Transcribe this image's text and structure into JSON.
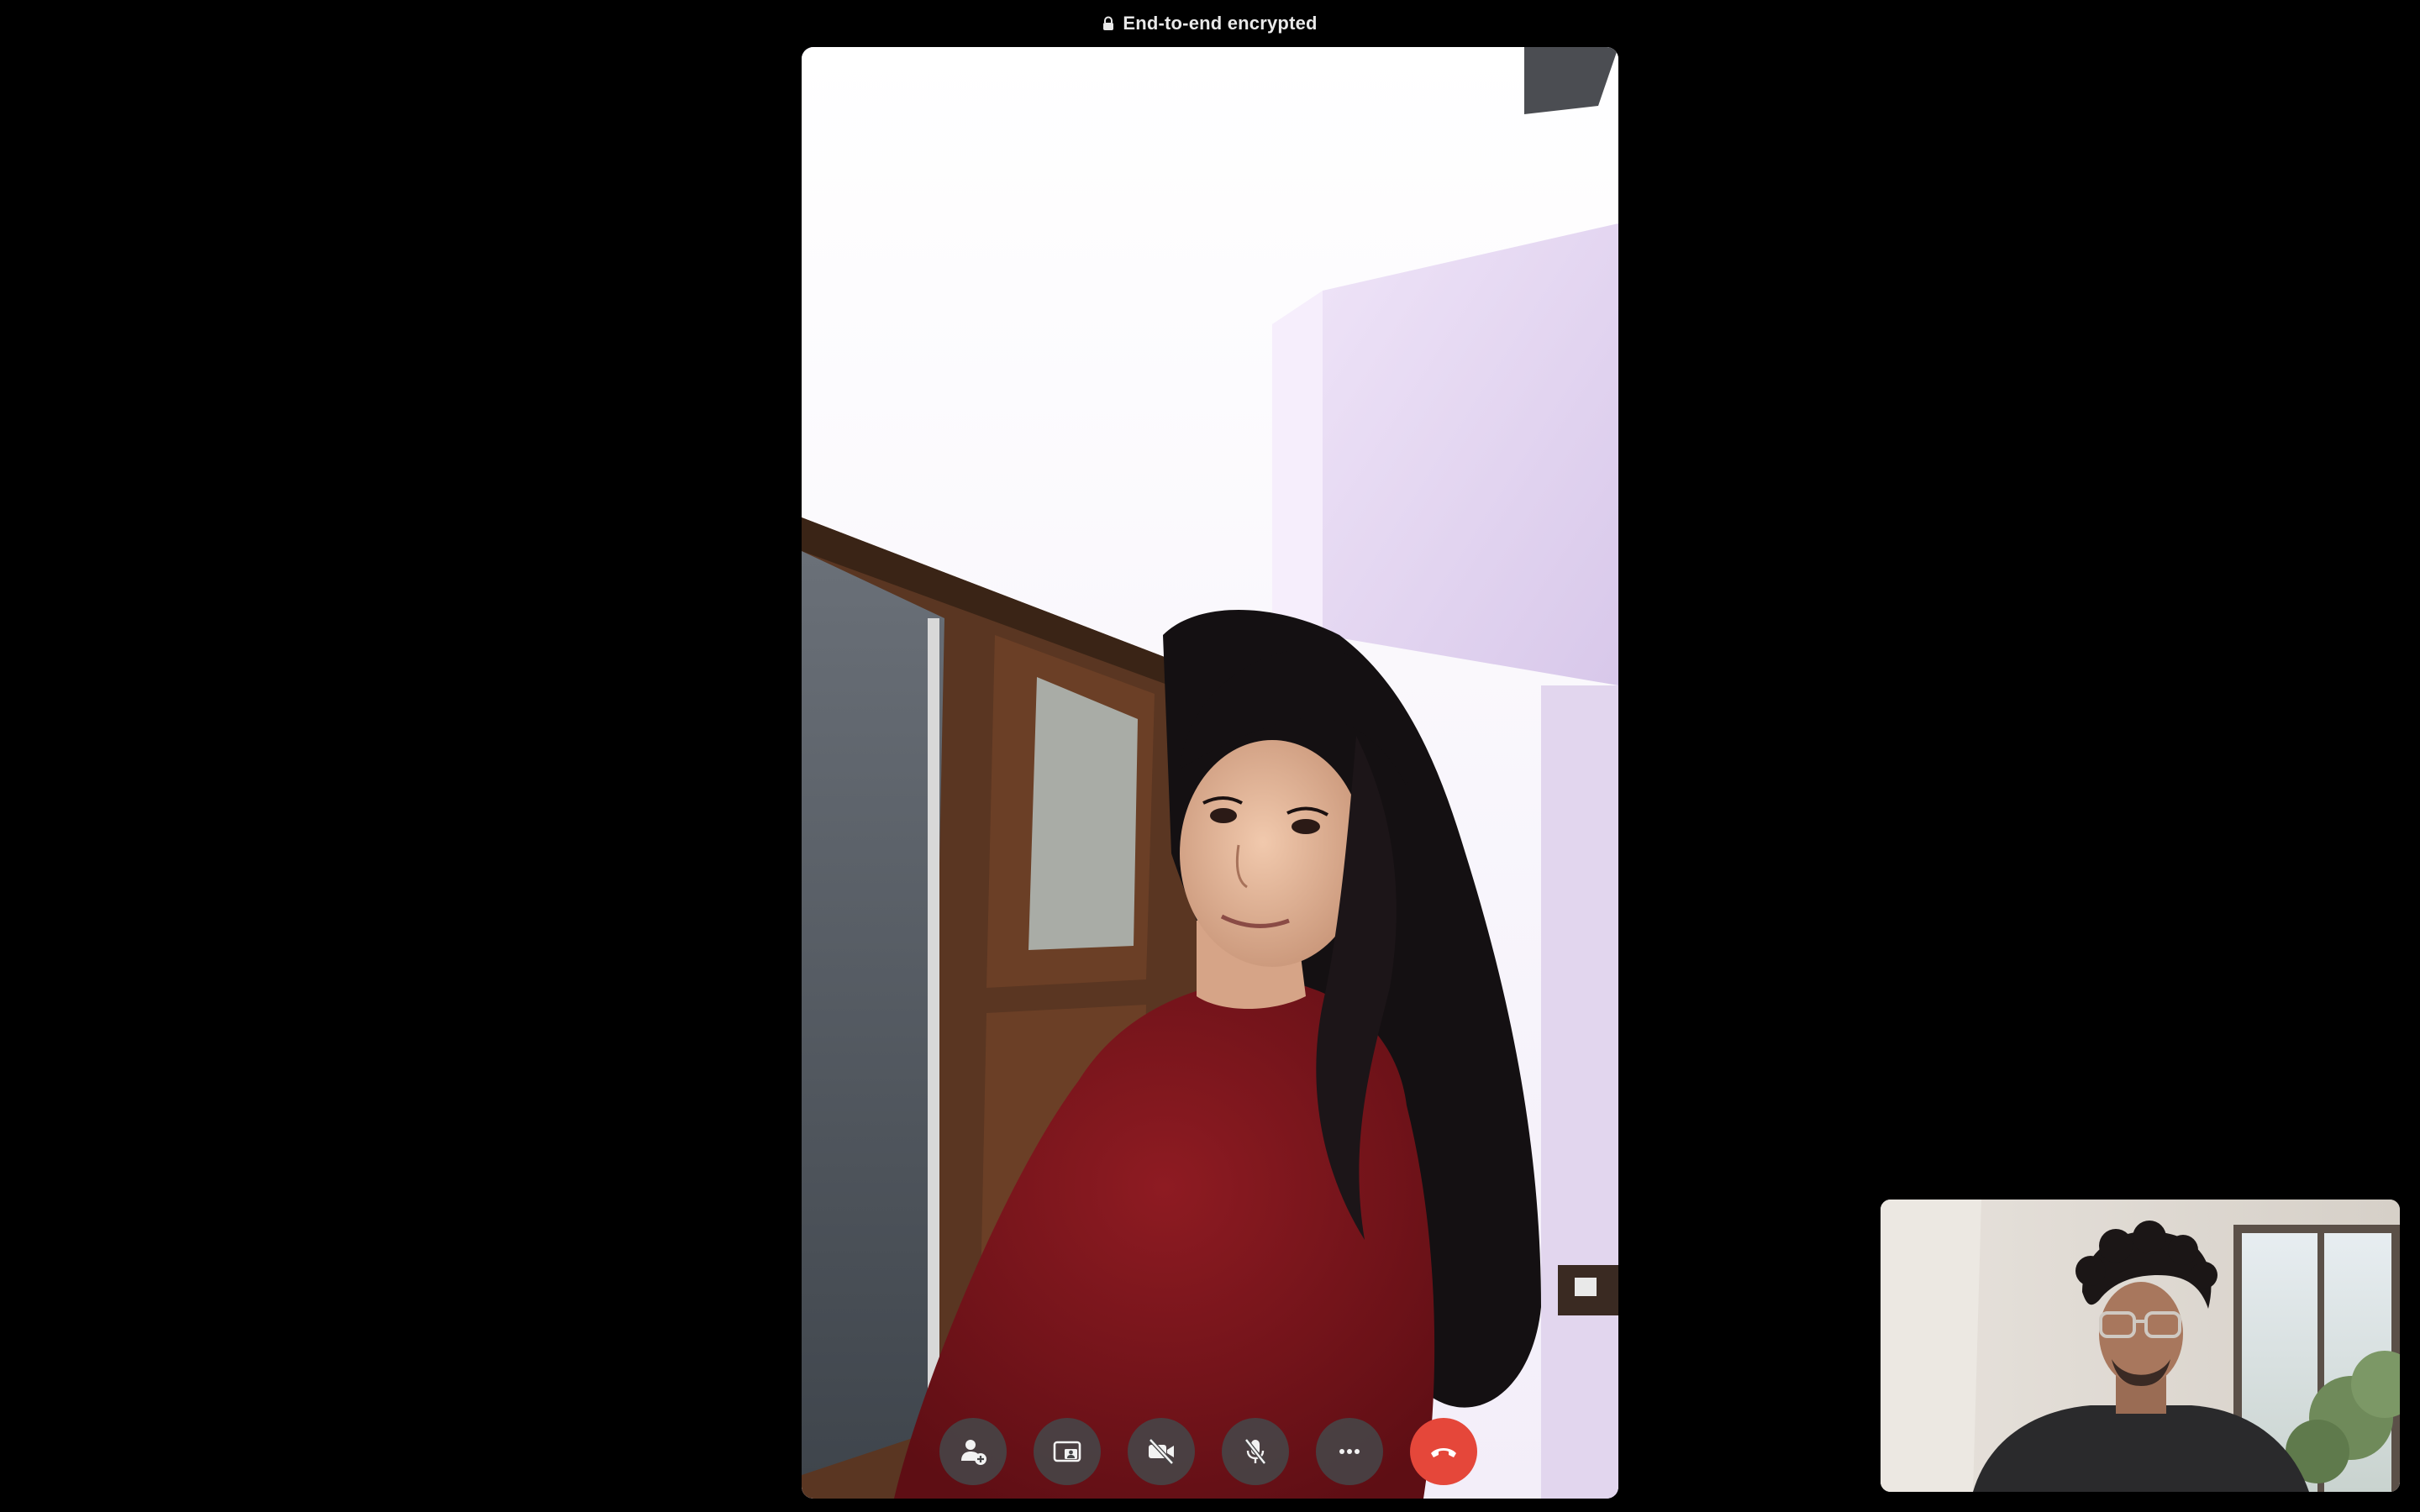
{
  "header": {
    "encryption_label": "End-to-end encrypted",
    "icon": "lock-icon"
  },
  "call": {
    "remote_video": "remote-participant-video",
    "self_video": "self-preview-video"
  },
  "controls": [
    {
      "name": "add-participant-button",
      "icon": "person-add-icon"
    },
    {
      "name": "share-screen-button",
      "icon": "screen-share-icon"
    },
    {
      "name": "camera-toggle-button",
      "icon": "video-off-icon"
    },
    {
      "name": "mute-button",
      "icon": "mic-off-icon"
    },
    {
      "name": "more-options-button",
      "icon": "more-horizontal-icon"
    },
    {
      "name": "end-call-button",
      "icon": "phone-hangup-icon"
    }
  ],
  "colors": {
    "background": "#000000",
    "control_bg": "#464648",
    "end_call": "#e5473a",
    "header_text": "#e9e9e9"
  }
}
